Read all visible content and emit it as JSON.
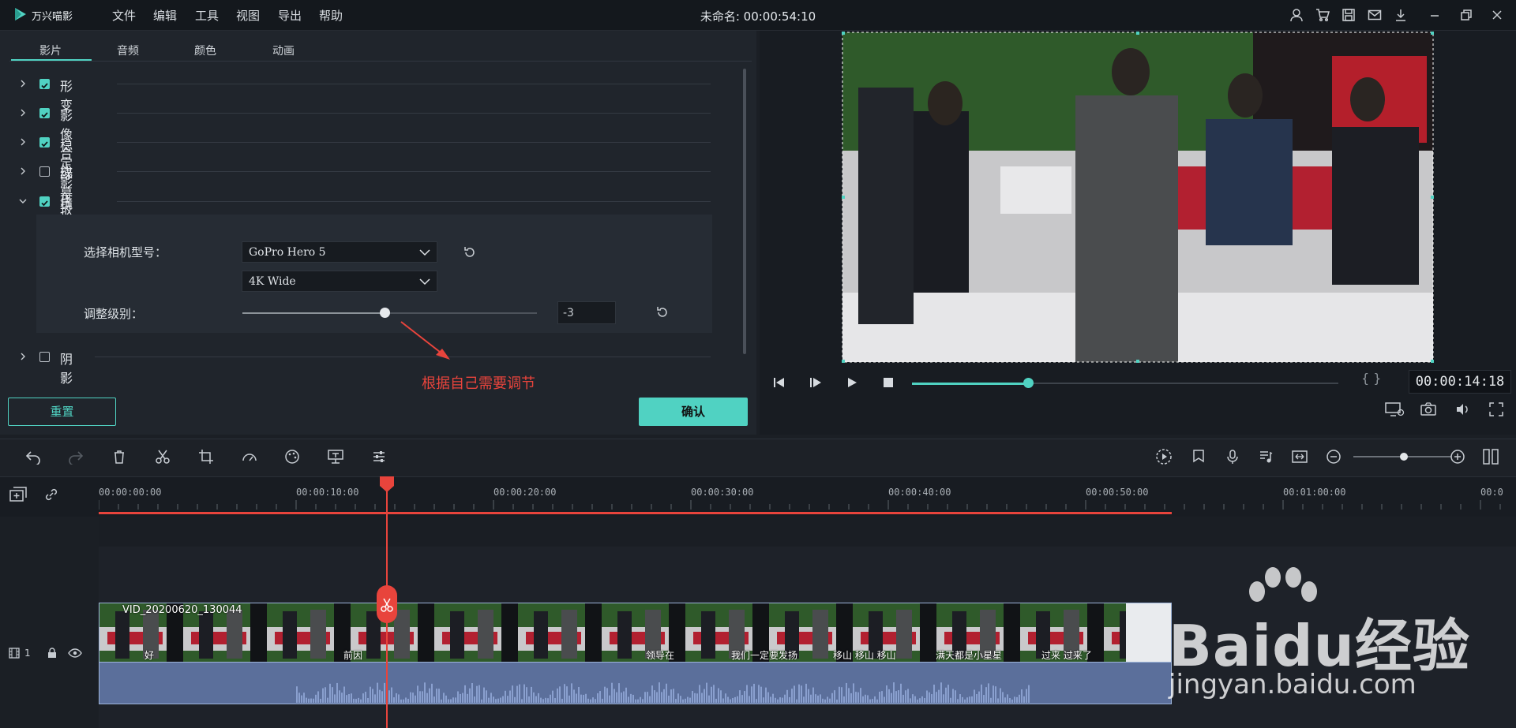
{
  "app": {
    "name": "万兴喵影",
    "project_title": "未命名: 00:00:54:10",
    "menu": [
      "文件",
      "编辑",
      "工具",
      "视图",
      "导出",
      "帮助"
    ]
  },
  "left_panel": {
    "tabs": [
      "影片",
      "音频",
      "颜色",
      "动画"
    ],
    "active_tab": "影片",
    "sections": [
      {
        "label": "形变",
        "checked": true,
        "expanded": false
      },
      {
        "label": "影像合成",
        "checked": true,
        "expanded": false
      },
      {
        "label": "稳定影片",
        "checked": true,
        "expanded": false
      },
      {
        "label": "绿幕抠像",
        "checked": false,
        "expanded": false
      },
      {
        "label": "镜头校正",
        "checked": true,
        "expanded": true
      },
      {
        "label": "阴影",
        "checked": false,
        "expanded": false
      }
    ],
    "lens": {
      "camera_label": "选择相机型号：",
      "camera_model": "GoPro Hero 5",
      "resolution": "4K Wide",
      "level_label": "调整级别：",
      "level_value": "-3",
      "slider_fraction": 0.4
    },
    "annotation": "根据自己需要调节",
    "reset_label": "重置",
    "confirm_label": "确认"
  },
  "preview": {
    "timecode": "00:00:14:18",
    "progress_fraction": 0.27,
    "bracket_icons": "{ }"
  },
  "timeline": {
    "ruler_labels": [
      "00:00:00:00",
      "00:00:10:00",
      "00:00:20:00",
      "00:00:30:00",
      "00:00:40:00",
      "00:00:50:00",
      "00:01:00:00",
      "00:0"
    ],
    "track_number": "1",
    "clip_name": "VID_20200620_130044",
    "subtitles": [
      "好",
      "前因",
      "领导在",
      "我们一定要发扬",
      "移山  移山  移山",
      "满天都是小星星",
      "过来  过来了"
    ]
  },
  "watermark": {
    "text": "Baidu经验",
    "url": "jingyan.baidu.com"
  },
  "colors": {
    "accent": "#50d2c2",
    "playhead": "#e8443c",
    "panel_bg": "#20252c"
  }
}
